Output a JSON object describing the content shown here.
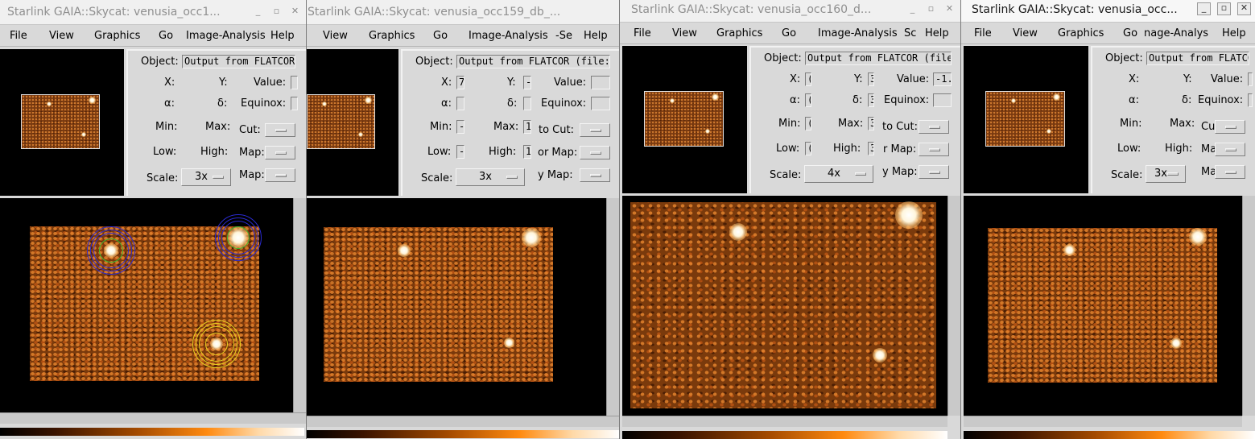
{
  "menus": [
    "File",
    "View",
    "Graphics",
    "Go",
    "Image-Analysis",
    "Help"
  ],
  "windows": [
    {
      "title": "Starlink GAIA::Skycat: venusia_occ1...",
      "menus": [
        "File",
        "View",
        "Graphics",
        "Go",
        "Image-Analysis",
        "Help"
      ],
      "labels": {
        "object": "Object:",
        "x": "X:",
        "y": "Y:",
        "value": "Value:",
        "alpha": "α:",
        "delta": "δ:",
        "equinox": "Equinox:",
        "min": "Min:",
        "max": "Max:",
        "cut": "Cut:",
        "low": "Low:",
        "high": "High:",
        "map1": "Map:",
        "scale": "Scale:",
        "map2": "Map:"
      },
      "object_value": "Output from FLATCOR",
      "x_value": "",
      "y_value": "",
      "pixel_value": "",
      "scale": "3x"
    },
    {
      "title": "Starlink GAIA::Skycat: venusia_occ159_db_...",
      "menus": [
        "View",
        "Graphics",
        "Go",
        "Image-Analysis",
        "-Se",
        "Help"
      ],
      "labels": {
        "object": "Object:",
        "x": "X:",
        "y": "Y:",
        "value": "Value:",
        "alpha": "α:",
        "delta": "δ:",
        "equinox": "Equinox:",
        "min": "Min:",
        "max": "Max:",
        "cut": "to Cut:",
        "low": "Low:",
        "high": "High:",
        "map1": "or Map:",
        "scale": "Scale:",
        "map2": "y Map:"
      },
      "object_value": "Output from FLATCOR (file:v",
      "x_value": "7",
      "y_value": "-",
      "min_value": "-",
      "max_value": "1",
      "low_value": "-",
      "high_value": "1",
      "scale": "3x"
    },
    {
      "title": "Starlink GAIA::Skycat: venusia_occ160_d...",
      "menus": [
        "File",
        "View",
        "Graphics",
        "Go",
        "Image-Analysis",
        "Sc",
        "Help"
      ],
      "labels": {
        "object": "Object:",
        "x": "X:",
        "y": "Y:",
        "value": "Value:",
        "alpha": "α:",
        "delta": "δ:",
        "equinox": "Equinox:",
        "min": "Min:",
        "max": "Max:",
        "cut": "to Cut:",
        "low": "Low:",
        "high": "High:",
        "map1": "r Map:",
        "scale": "Scale:",
        "map2": "y Map:"
      },
      "object_value": "Output from FLATCOR (file",
      "x_value": "(",
      "y_value": "3",
      "pixel_value": "-1.",
      "alpha_value": "(",
      "delta_value": "3",
      "min_value": "(",
      "max_value": "3",
      "low_value": "(",
      "high_value": "3",
      "scale": "4x"
    },
    {
      "title": "Starlink GAIA::Skycat: venusia_occ...",
      "menus": [
        "File",
        "View",
        "Graphics",
        "Go",
        "nage-Analys",
        "Help"
      ],
      "labels": {
        "object": "Object:",
        "x": "X:",
        "y": "Y:",
        "value": "Value:",
        "alpha": "α:",
        "delta": "δ:",
        "equinox": "Equinox:",
        "min": "Min:",
        "max": "Max:",
        "cut": "Cut:",
        "low": "Low:",
        "high": "High:",
        "map1": "Map:",
        "scale": "Scale:",
        "map2": "Map:"
      },
      "object_value": "Output from FLATCO",
      "scale": "3x"
    }
  ],
  "window_button_icons": [
    "minimize-icon",
    "maximize-icon",
    "close-icon"
  ],
  "window_button_glyphs": {
    "minimize": "_",
    "maximize": "▫",
    "close": "✕"
  },
  "colors": {
    "image_bg": "#000000",
    "ring_green": "#3dbb34",
    "ring_blue": "#2a2ad0",
    "ring_yellow": "#e8d020"
  }
}
